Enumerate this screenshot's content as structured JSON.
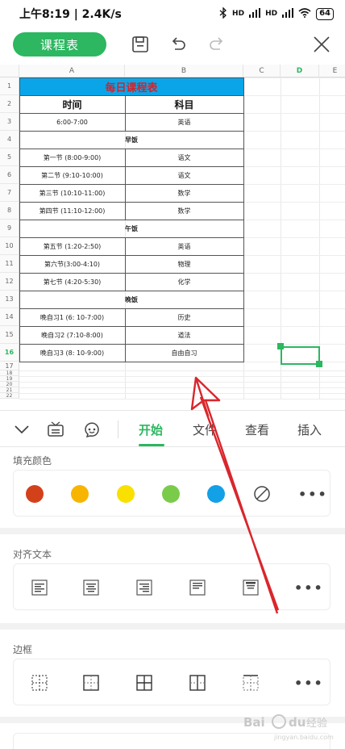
{
  "status": {
    "time": "上午8:19 | 2.4K/s",
    "battery": "64",
    "network": "HD"
  },
  "toolbar": {
    "title": "课程表"
  },
  "sheet": {
    "columns": [
      "A",
      "B",
      "C",
      "D",
      "E"
    ],
    "rows": [
      "1",
      "2",
      "3",
      "4",
      "5",
      "6",
      "7",
      "8",
      "9",
      "10",
      "11",
      "12",
      "13",
      "14",
      "15",
      "16",
      "17",
      "18",
      "19",
      "20",
      "21",
      "22"
    ],
    "title": "每日课程表",
    "header": {
      "time": "时间",
      "subject": "科目"
    },
    "entries": [
      {
        "row": "3",
        "time": "6:00-7:00",
        "subject": "英语"
      },
      {
        "row": "4",
        "meal": "早饭"
      },
      {
        "row": "5",
        "time": "第一节 (8:00-9:00)",
        "subject": "语文"
      },
      {
        "row": "6",
        "time": "第二节 (9:10-10:00)",
        "subject": "语文"
      },
      {
        "row": "7",
        "time": "第三节 (10:10-11:00)",
        "subject": "数学"
      },
      {
        "row": "8",
        "time": "第四节 (11:10-12:00)",
        "subject": "数学"
      },
      {
        "row": "9",
        "meal": "午饭"
      },
      {
        "row": "10",
        "time": "第五节 (1:20-2:50)",
        "subject": "英语"
      },
      {
        "row": "11",
        "time": "第六节(3:00-4:10)",
        "subject": "物理"
      },
      {
        "row": "12",
        "time": "第七节 (4:20-5:30)",
        "subject": "化学"
      },
      {
        "row": "13",
        "meal": "晚饭"
      },
      {
        "row": "14",
        "time": "晚自习1 (6: 10-7:00)",
        "subject": "历史"
      },
      {
        "row": "15",
        "time": "晚自习2 (7:10-8:00)",
        "subject": "道法"
      },
      {
        "row": "16",
        "time": "晚自习3 (8: 10-9:00)",
        "subject": "自由自习"
      }
    ],
    "selected_column": "D",
    "selected_row": "16"
  },
  "tabs": [
    "开始",
    "文件",
    "查看",
    "插入"
  ],
  "active_tab": "开始",
  "sections": {
    "fill": {
      "title": "填充颜色",
      "colors": [
        "#d3411b",
        "#f7b500",
        "#f9e000",
        "#7bcb4a",
        "#12a0e6"
      ]
    },
    "align": {
      "title": "对齐文本"
    },
    "border": {
      "title": "边框"
    }
  },
  "more_label": "•••",
  "accent": "#2cb760",
  "arrow_color": "#d9262c",
  "watermark": "Bai du 经验"
}
